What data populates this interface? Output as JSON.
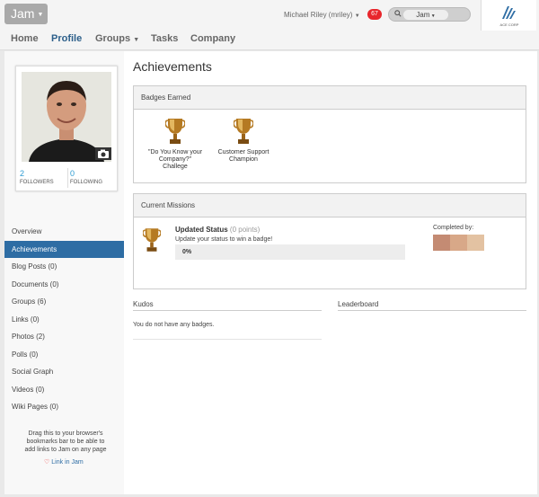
{
  "topbar": {
    "app_label": "Jam",
    "user_label": "Michael Riley (mriley)",
    "notification_count": "67",
    "search_scope": "Jam",
    "logo_text": "ACE CORP"
  },
  "nav": {
    "items": [
      "Home",
      "Profile",
      "Groups",
      "Tasks",
      "Company"
    ],
    "active": "Profile"
  },
  "profile": {
    "followers_count": "2",
    "followers_label": "FOLLOWERS",
    "following_count": "0",
    "following_label": "FOLLOWING"
  },
  "sidebar": {
    "items": [
      {
        "label": "Overview"
      },
      {
        "label": "Achievements"
      },
      {
        "label": "Blog Posts (0)"
      },
      {
        "label": "Documents (0)"
      },
      {
        "label": "Groups (6)"
      },
      {
        "label": "Links (0)"
      },
      {
        "label": "Photos (2)"
      },
      {
        "label": "Polls (0)"
      },
      {
        "label": "Social Graph"
      },
      {
        "label": "Videos (0)"
      },
      {
        "label": "Wiki Pages (0)"
      }
    ],
    "active_index": 1,
    "bookmark_text": "Drag this to your browser's bookmarks bar to be able to add links to Jam on any page",
    "bookmark_link": "Link in Jam"
  },
  "main": {
    "title": "Achievements",
    "badges_header": "Badges Earned",
    "badges": [
      {
        "label": "\"Do You Know your Company?\" Challege"
      },
      {
        "label": "Customer Support Champion"
      }
    ],
    "missions_header": "Current Missions",
    "mission": {
      "title": "Updated Status",
      "points": "(0 points)",
      "description": "Update your status to win a badge!",
      "progress_label": "0%",
      "progress": 0,
      "completed_by_label": "Completed by:"
    },
    "kudos_header": "Kudos",
    "kudos_text": "You do not have any badges.",
    "leaderboard_header": "Leaderboard"
  },
  "colors": {
    "accent": "#2e6da4",
    "link": "#2c9bd2",
    "badge": "#e8262c"
  }
}
